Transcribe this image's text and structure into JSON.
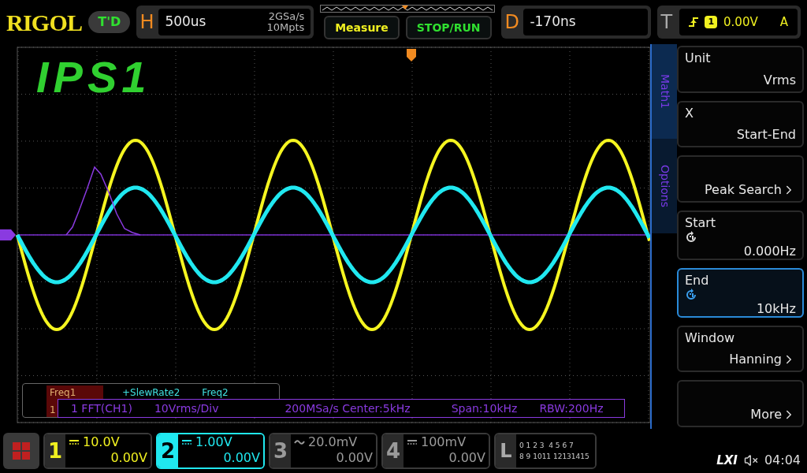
{
  "brand": "RIGOL",
  "mode_badge": "T'D",
  "horizontal": {
    "label": "H",
    "timebase": "500us",
    "sample_rate": "2GSa/s",
    "memory_depth": "10Mpts"
  },
  "buttons": [
    {
      "label": "Measure",
      "kind": "measure"
    },
    {
      "label": "STOP/RUN",
      "kind": "run"
    }
  ],
  "delay": {
    "label": "D",
    "value": "-170ns"
  },
  "trigger": {
    "label": "T",
    "source": "1",
    "level": "0.00V",
    "mode": "A"
  },
  "annotation": "IPS1",
  "side_tabs": [
    {
      "label": "Math1",
      "selected": true
    },
    {
      "label": "Options",
      "selected": false
    }
  ],
  "menu": [
    {
      "kind": "plain",
      "title": "Unit",
      "value": "Vrms",
      "selected": false
    },
    {
      "kind": "plain",
      "title": "X",
      "value": "Start-End",
      "selected": false
    },
    {
      "kind": "submenu",
      "value": "Peak Search",
      "selected": false
    },
    {
      "kind": "knob",
      "title": "Start",
      "value": "0.000Hz",
      "selected": false
    },
    {
      "kind": "knob",
      "title": "End",
      "value": "10kHz",
      "selected": true
    },
    {
      "kind": "submenu",
      "title": "Window",
      "value": "Hanning",
      "selected": false
    },
    {
      "kind": "submenu",
      "value": "More",
      "selected": false
    }
  ],
  "measurements": [
    {
      "label": "Freq1",
      "highlighted": true,
      "color": "#e0b070"
    },
    {
      "label": "+SlewRate2",
      "highlighted": false,
      "color": "#40e0e0"
    },
    {
      "label": "Freq2",
      "highlighted": false,
      "color": "#40e0e0"
    }
  ],
  "measurement_value_partial": "1",
  "math_info": [
    "1 FFT(CH1)",
    "10Vrms/Div",
    "200MSa/s Center:5kHz",
    "Span:10kHz",
    "RBW:200Hz"
  ],
  "channels": [
    {
      "number": "1",
      "kind": "dc",
      "scale": "10.0V",
      "offset": "0.00V",
      "selected": false,
      "color": "#f0f020"
    },
    {
      "number": "2",
      "kind": "dc",
      "scale": "1.00V",
      "offset": "0.00V",
      "selected": true,
      "color": "#20e8f0"
    },
    {
      "number": "3",
      "kind": "ac",
      "scale": "20.0mV",
      "offset": "0.00V",
      "selected": false,
      "color": "#9a9a9a"
    },
    {
      "number": "4",
      "kind": "dc",
      "scale": "100mV",
      "offset": "0.00V",
      "selected": false,
      "color": "#9a9a9a"
    }
  ],
  "logic": {
    "label": "L",
    "row_1": "0 1 2 3  4 5 6 7",
    "row_2": "8 9 1011 12131415"
  },
  "status": {
    "lxi": "LXI",
    "muted": true,
    "time": "04:04"
  }
}
